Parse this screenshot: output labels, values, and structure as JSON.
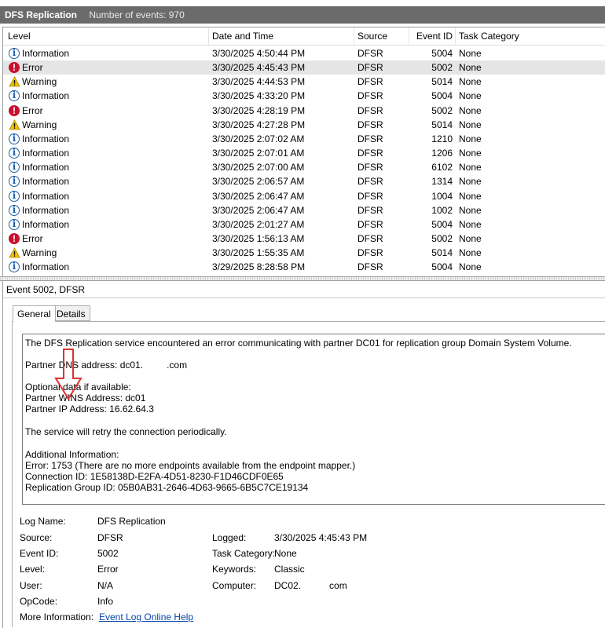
{
  "window": {
    "title": "DFS Replication",
    "event_count": "Number of events: 970"
  },
  "columns": {
    "level": "Level",
    "date": "Date and Time",
    "source": "Source",
    "event_id": "Event ID",
    "category": "Task Category"
  },
  "events": [
    {
      "level": "Information",
      "icon": "info-icon",
      "date": "3/30/2025 4:50:44 PM",
      "source": "DFSR",
      "id": "5004",
      "category": "None"
    },
    {
      "level": "Error",
      "icon": "error-icon",
      "date": "3/30/2025 4:45:43 PM",
      "source": "DFSR",
      "id": "5002",
      "category": "None",
      "selected": true
    },
    {
      "level": "Warning",
      "icon": "warning-icon",
      "date": "3/30/2025 4:44:53 PM",
      "source": "DFSR",
      "id": "5014",
      "category": "None"
    },
    {
      "level": "Information",
      "icon": "info-icon",
      "date": "3/30/2025 4:33:20 PM",
      "source": "DFSR",
      "id": "5004",
      "category": "None"
    },
    {
      "level": "Error",
      "icon": "error-icon",
      "date": "3/30/2025 4:28:19 PM",
      "source": "DFSR",
      "id": "5002",
      "category": "None"
    },
    {
      "level": "Warning",
      "icon": "warning-icon",
      "date": "3/30/2025 4:27:28 PM",
      "source": "DFSR",
      "id": "5014",
      "category": "None"
    },
    {
      "level": "Information",
      "icon": "info-icon",
      "date": "3/30/2025 2:07:02 AM",
      "source": "DFSR",
      "id": "1210",
      "category": "None"
    },
    {
      "level": "Information",
      "icon": "info-icon",
      "date": "3/30/2025 2:07:01 AM",
      "source": "DFSR",
      "id": "1206",
      "category": "None"
    },
    {
      "level": "Information",
      "icon": "info-icon",
      "date": "3/30/2025 2:07:00 AM",
      "source": "DFSR",
      "id": "6102",
      "category": "None"
    },
    {
      "level": "Information",
      "icon": "info-icon",
      "date": "3/30/2025 2:06:57 AM",
      "source": "DFSR",
      "id": "1314",
      "category": "None"
    },
    {
      "level": "Information",
      "icon": "info-icon",
      "date": "3/30/2025 2:06:47 AM",
      "source": "DFSR",
      "id": "1004",
      "category": "None"
    },
    {
      "level": "Information",
      "icon": "info-icon",
      "date": "3/30/2025 2:06:47 AM",
      "source": "DFSR",
      "id": "1002",
      "category": "None"
    },
    {
      "level": "Information",
      "icon": "info-icon",
      "date": "3/30/2025 2:01:27 AM",
      "source": "DFSR",
      "id": "5004",
      "category": "None"
    },
    {
      "level": "Error",
      "icon": "error-icon",
      "date": "3/30/2025 1:56:13 AM",
      "source": "DFSR",
      "id": "5002",
      "category": "None"
    },
    {
      "level": "Warning",
      "icon": "warning-icon",
      "date": "3/30/2025 1:55:35 AM",
      "source": "DFSR",
      "id": "5014",
      "category": "None"
    },
    {
      "level": "Information",
      "icon": "info-icon",
      "date": "3/29/2025 8:28:58 PM",
      "source": "DFSR",
      "id": "5004",
      "category": "None"
    }
  ],
  "detail": {
    "header": "Event 5002, DFSR",
    "tabs": {
      "general": "General",
      "details": "Details"
    },
    "message": {
      "line1": "The DFS Replication service encountered an error communicating with partner DC01 for replication group Domain System Volume.",
      "dns_prefix": "Partner DNS address: dc01.",
      "dns_suffix": ".com",
      "optional": "Optional data if available:",
      "wins": "Partner WINS Address: dc01",
      "ip": "Partner IP Address: 16.62.64.3",
      "retry": "The service will retry the connection periodically.",
      "additional": "Additional Information:",
      "error": "Error: 1753 (There are no more endpoints available from the endpoint mapper.)",
      "connection": "Connection ID: 1E58138D-E2FA-4D51-8230-F1D46CDF0E65",
      "group": "Replication Group ID: 05B0AB31-2646-4D63-9665-6B5C7CE19134"
    },
    "fields": {
      "log_name_label": "Log Name:",
      "log_name": "DFS Replication",
      "source_label": "Source:",
      "source": "DFSR",
      "logged_label": "Logged:",
      "logged": "3/30/2025 4:45:43 PM",
      "event_id_label": "Event ID:",
      "event_id": "5002",
      "task_label": "Task Category:",
      "task": "None",
      "level_label": "Level:",
      "level": "Error",
      "keywords_label": "Keywords:",
      "keywords": "Classic",
      "user_label": "User:",
      "user": "N/A",
      "computer_label": "Computer:",
      "computer_prefix": "DC02.",
      "computer_suffix": "com",
      "opcode_label": "OpCode:",
      "opcode": "Info",
      "more_label": "More Information:",
      "more_link": "Event Log Online Help"
    }
  },
  "colors": {
    "title_bar": "#6b6b6b",
    "selected_row": "#e5e5e5",
    "error": "#c8102e",
    "info": "#1d5fa8",
    "warning": "#f2c200",
    "arrow": "#e03030",
    "link": "#0645ad"
  }
}
